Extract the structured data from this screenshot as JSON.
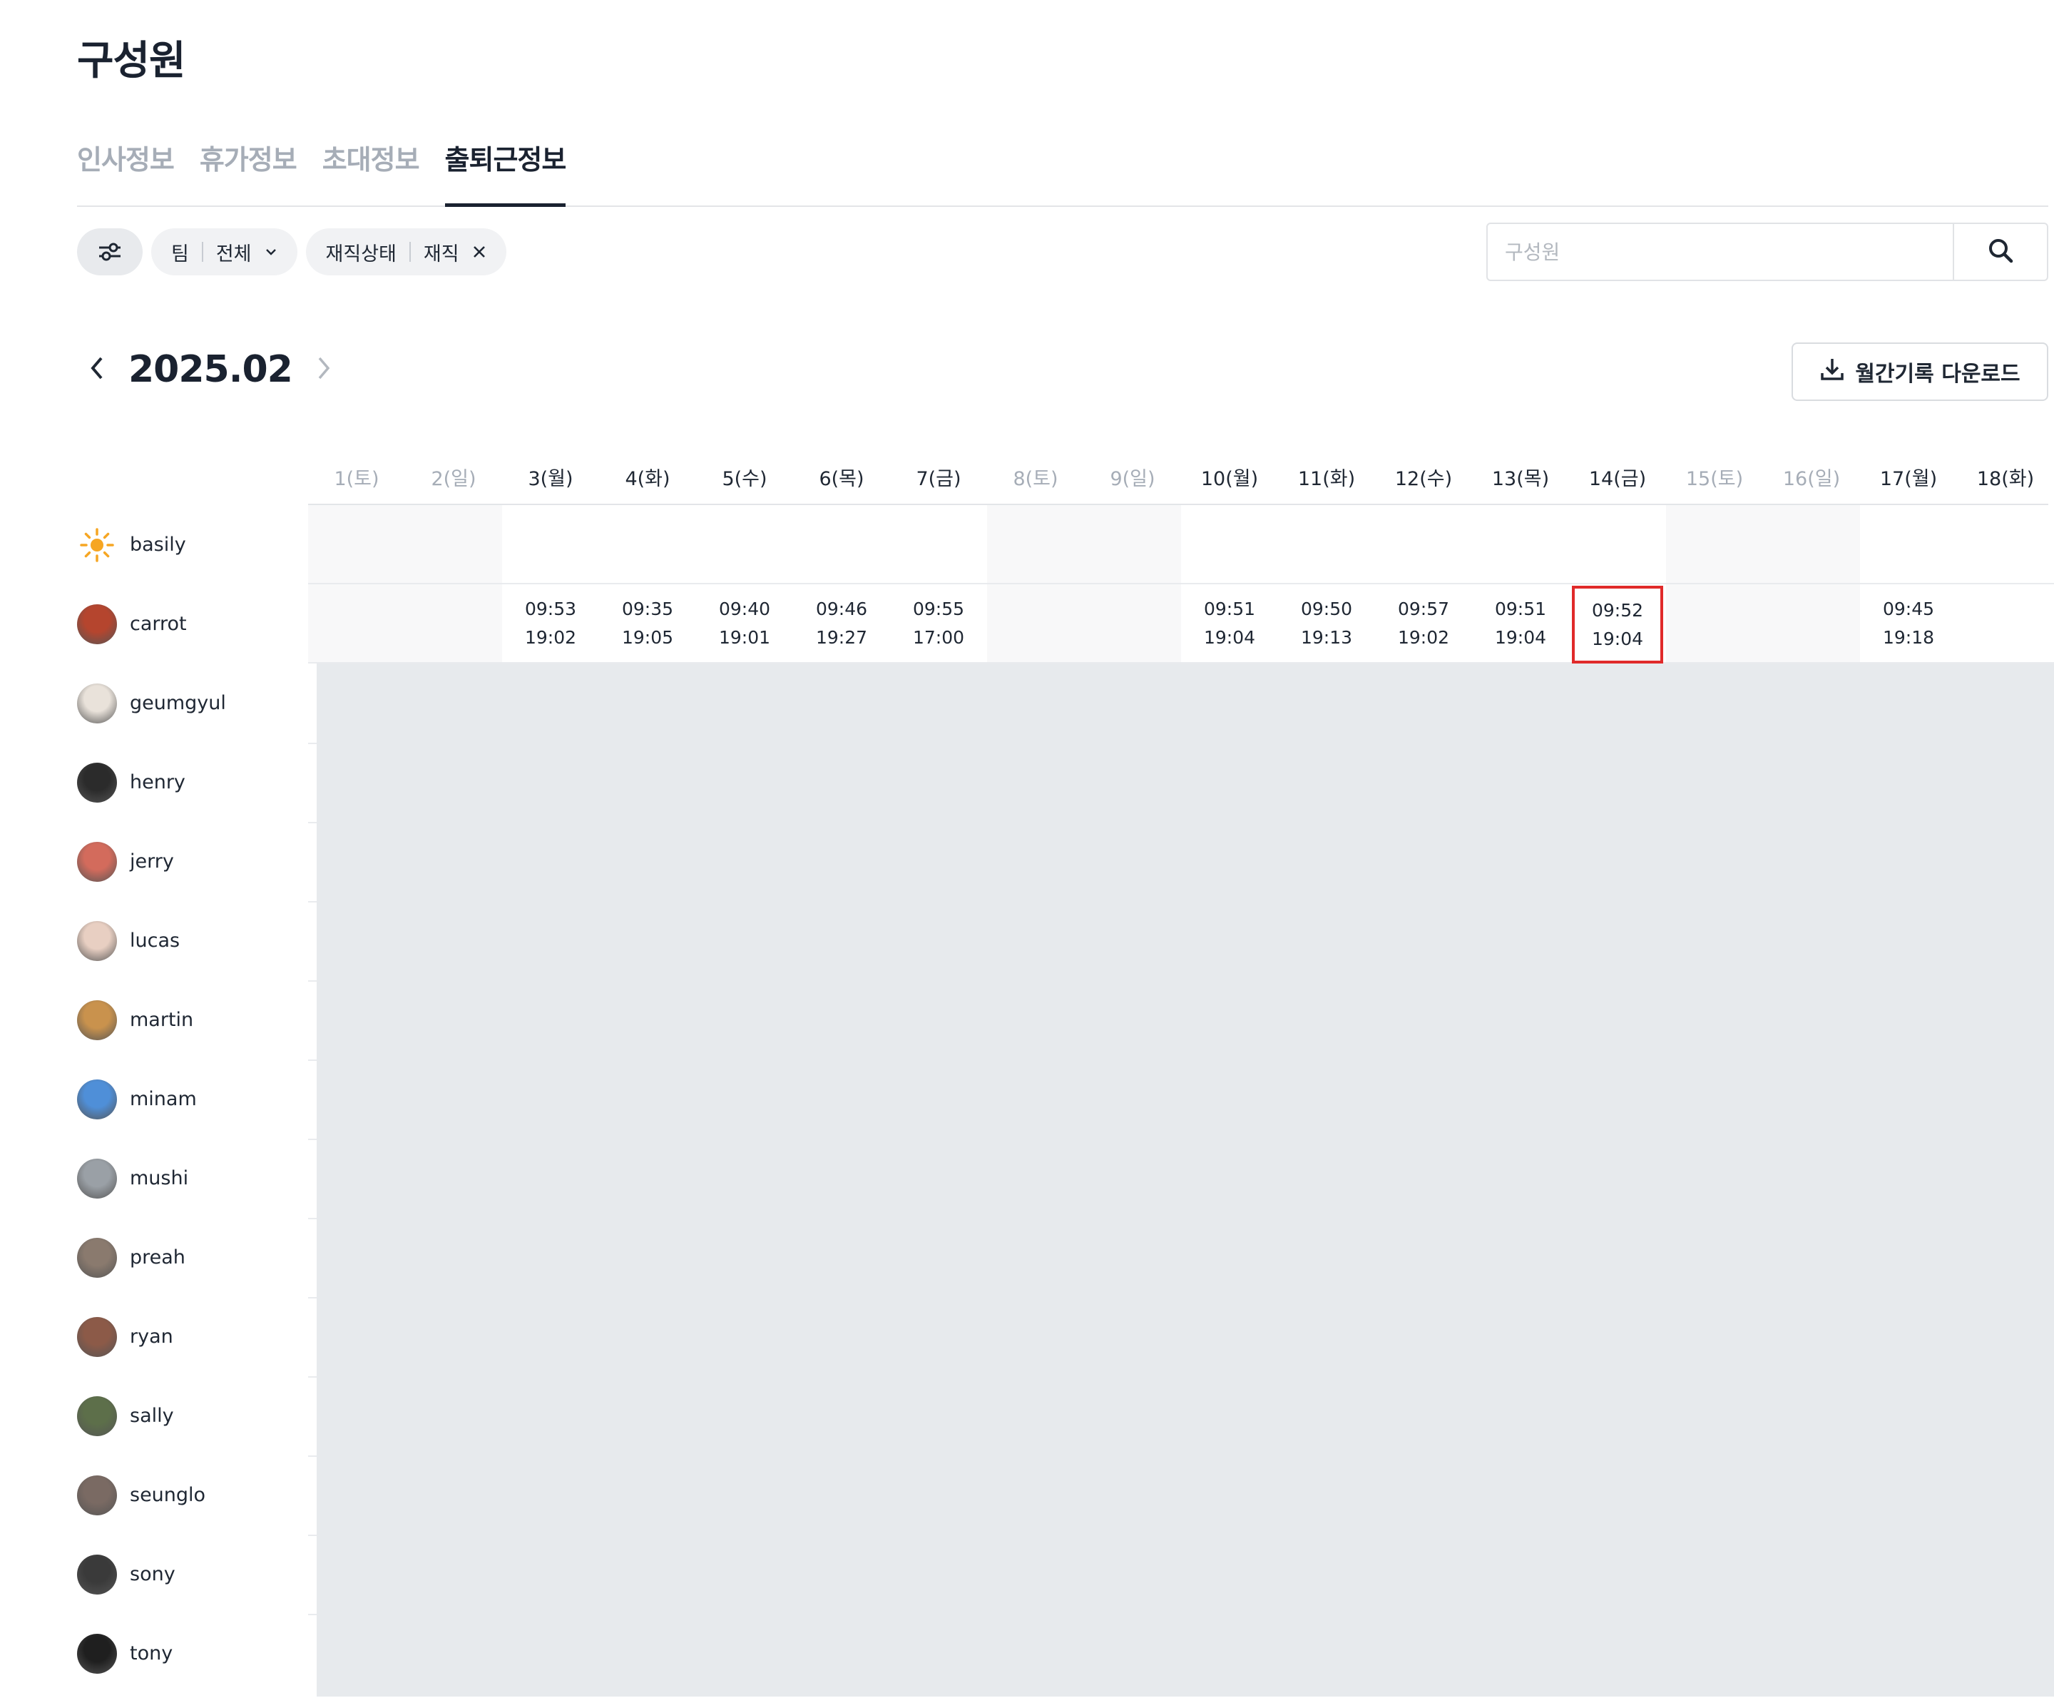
{
  "page": {
    "title": "구성원"
  },
  "tabs": [
    {
      "label": "인사정보",
      "active": false
    },
    {
      "label": "휴가정보",
      "active": false
    },
    {
      "label": "초대정보",
      "active": false
    },
    {
      "label": "출퇴근정보",
      "active": true
    }
  ],
  "filters": {
    "filter_icon": "sliders-icon",
    "team": {
      "label": "팀",
      "value": "전체"
    },
    "status": {
      "label": "재직상태",
      "value": "재직"
    }
  },
  "search": {
    "placeholder": "구성원",
    "icon": "search-icon"
  },
  "month": {
    "label": "2025.02"
  },
  "download": {
    "label": "월간기록 다운로드",
    "icon": "download-icon"
  },
  "days": [
    {
      "label": "1(토)",
      "weekend": true
    },
    {
      "label": "2(일)",
      "weekend": true
    },
    {
      "label": "3(월)",
      "weekend": false
    },
    {
      "label": "4(화)",
      "weekend": false
    },
    {
      "label": "5(수)",
      "weekend": false
    },
    {
      "label": "6(목)",
      "weekend": false
    },
    {
      "label": "7(금)",
      "weekend": false
    },
    {
      "label": "8(토)",
      "weekend": true
    },
    {
      "label": "9(일)",
      "weekend": true
    },
    {
      "label": "10(월)",
      "weekend": false
    },
    {
      "label": "11(화)",
      "weekend": false
    },
    {
      "label": "12(수)",
      "weekend": false
    },
    {
      "label": "13(목)",
      "weekend": false
    },
    {
      "label": "14(금)",
      "weekend": false
    },
    {
      "label": "15(토)",
      "weekend": true
    },
    {
      "label": "16(일)",
      "weekend": true
    },
    {
      "label": "17(월)",
      "weekend": false
    },
    {
      "label": "18(화)",
      "weekend": false
    }
  ],
  "members": [
    {
      "name": "basily",
      "avatar_color": "#ffffff",
      "icon": "sun-icon"
    },
    {
      "name": "carrot",
      "avatar_color": "#b5452e"
    },
    {
      "name": "geumgyul",
      "avatar_color": "#e9e2da"
    },
    {
      "name": "henry",
      "avatar_color": "#2b2b2b"
    },
    {
      "name": "jerry",
      "avatar_color": "#d36b5c"
    },
    {
      "name": "lucas",
      "avatar_color": "#e8cfc2"
    },
    {
      "name": "martin",
      "avatar_color": "#c9924d"
    },
    {
      "name": "minam",
      "avatar_color": "#4f8fd8"
    },
    {
      "name": "mushi",
      "avatar_color": "#9aa0a6"
    },
    {
      "name": "preah",
      "avatar_color": "#8a7a6e"
    },
    {
      "name": "ryan",
      "avatar_color": "#8c5a48"
    },
    {
      "name": "sally",
      "avatar_color": "#5d6f4a"
    },
    {
      "name": "seunglo",
      "avatar_color": "#7a6a63"
    },
    {
      "name": "sony",
      "avatar_color": "#3a3a3a"
    },
    {
      "name": "tony",
      "avatar_color": "#1f1f1f"
    }
  ],
  "attendance": {
    "basily": [],
    "carrot": [
      {
        "day": 3,
        "in": "09:53",
        "out": "19:02"
      },
      {
        "day": 4,
        "in": "09:35",
        "out": "19:05"
      },
      {
        "day": 5,
        "in": "09:40",
        "out": "19:01"
      },
      {
        "day": 6,
        "in": "09:46",
        "out": "19:27"
      },
      {
        "day": 7,
        "in": "09:55",
        "out": "17:00"
      },
      {
        "day": 10,
        "in": "09:51",
        "out": "19:04"
      },
      {
        "day": 11,
        "in": "09:50",
        "out": "19:13"
      },
      {
        "day": 12,
        "in": "09:57",
        "out": "19:02"
      },
      {
        "day": 13,
        "in": "09:51",
        "out": "19:04"
      },
      {
        "day": 14,
        "in": "09:52",
        "out": "19:04",
        "highlighted": true
      },
      {
        "day": 17,
        "in": "09:45",
        "out": "19:18"
      }
    ]
  },
  "colors": {
    "highlight": "#e02a2a",
    "weekend_text": "#a6adb7",
    "loading_area": "#e7eaed"
  }
}
